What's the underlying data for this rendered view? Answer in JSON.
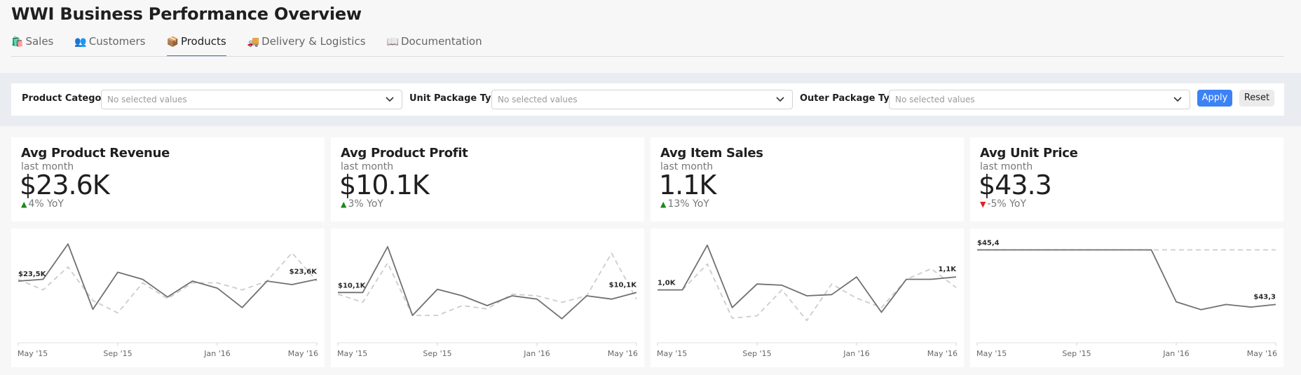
{
  "app": {
    "title": "WWI Business Performance Overview"
  },
  "tabs": [
    {
      "icon": "🛍️",
      "icon_name": "shopping-bags-icon",
      "label": "Sales",
      "active": false
    },
    {
      "icon": "👥",
      "icon_name": "people-icon",
      "label": "Customers",
      "active": false
    },
    {
      "icon": "📦",
      "icon_name": "package-icon",
      "label": "Products",
      "active": true
    },
    {
      "icon": "🚚",
      "icon_name": "truck-icon",
      "label": "Delivery & Logistics",
      "active": false
    },
    {
      "icon": "📖",
      "icon_name": "book-icon",
      "label": "Documentation",
      "active": false
    }
  ],
  "filters": {
    "items": [
      {
        "label": "Product Category",
        "placeholder": "No selected values"
      },
      {
        "label": "Unit Package Type",
        "placeholder": "No selected values"
      },
      {
        "label": "Outer Package Type",
        "placeholder": "No selected values"
      }
    ],
    "apply_label": "Apply",
    "reset_label": "Reset"
  },
  "kpis": [
    {
      "title": "Avg Product Revenue",
      "period": "last month",
      "value": "$23.6K",
      "delta": "4% YoY",
      "direction": "up"
    },
    {
      "title": "Avg Product Profit",
      "period": "last month",
      "value": "$10.1K",
      "delta": "3% YoY",
      "direction": "up"
    },
    {
      "title": "Avg Item Sales",
      "period": "last month",
      "value": "1.1K",
      "delta": "13% YoY",
      "direction": "up"
    },
    {
      "title": "Avg Unit Price",
      "period": "last month",
      "value": "$43.3",
      "delta": "-5% YoY",
      "direction": "down"
    }
  ],
  "colors": {
    "accent": "#3b6fe0",
    "apply_button": "#3b82f6",
    "up": "#1a8a1a",
    "down": "#e02020",
    "series_current": "#707070",
    "series_previous": "#cccccc"
  },
  "chart_data": [
    {
      "type": "line",
      "x_ticks": [
        "May '15",
        "Sep '15",
        "Jan '16",
        "May '16"
      ],
      "series": [
        {
          "style": "solid",
          "values": [
            23.5,
            23.6,
            25.6,
            21.9,
            24.0,
            23.6,
            22.6,
            23.5,
            23.1,
            22.0,
            23.5,
            23.3,
            23.6
          ]
        },
        {
          "style": "dashed",
          "values": [
            23.6,
            23.0,
            24.3,
            22.4,
            21.7,
            23.4,
            22.5,
            23.4,
            23.4,
            23.0,
            23.5,
            25.1,
            23.5
          ]
        }
      ],
      "labels": {
        "first": "$23,5K",
        "last": "$23,6K"
      }
    },
    {
      "type": "line",
      "x_ticks": [
        "May '15",
        "Sep '15",
        "Jan '16",
        "May '16"
      ],
      "series": [
        {
          "style": "solid",
          "values": [
            10.0,
            10.0,
            11.4,
            9.3,
            10.1,
            9.9,
            9.6,
            9.9,
            9.8,
            9.2,
            9.9,
            9.8,
            10.0
          ]
        },
        {
          "style": "dashed",
          "values": [
            9.95,
            9.7,
            10.9,
            9.3,
            9.3,
            9.6,
            9.5,
            9.95,
            9.9,
            9.7,
            9.9,
            11.2,
            9.8
          ]
        }
      ],
      "labels": {
        "first": "$10,1K",
        "last": "$10,1K"
      }
    },
    {
      "type": "line",
      "x_ticks": [
        "May '15",
        "Sep '15",
        "Jan '16",
        "May '16"
      ],
      "series": [
        {
          "style": "solid",
          "values": [
            1.0,
            1.0,
            1.38,
            0.85,
            1.05,
            1.04,
            0.95,
            0.96,
            1.11,
            0.81,
            1.09,
            1.09,
            1.11
          ]
        },
        {
          "style": "dashed",
          "values": [
            1.0,
            1.0,
            1.22,
            0.76,
            0.78,
            1.0,
            0.74,
            1.05,
            0.93,
            0.85,
            1.09,
            1.18,
            1.02
          ]
        }
      ],
      "labels": {
        "first": "1,0K",
        "last": "1,1K"
      }
    },
    {
      "type": "line",
      "x_ticks": [
        "May '15",
        "Sep '15",
        "Jan '16",
        "May '16"
      ],
      "series": [
        {
          "style": "solid",
          "values": [
            45.4,
            45.4,
            45.4,
            45.4,
            45.4,
            45.4,
            45.4,
            45.4,
            43.4,
            43.1,
            43.3,
            43.2,
            43.3
          ]
        },
        {
          "style": "dashed",
          "values": [
            45.4,
            45.4,
            45.4,
            45.4,
            45.4,
            45.4,
            45.4,
            45.4,
            45.4,
            45.4,
            45.4,
            45.4,
            45.4
          ]
        }
      ],
      "labels": {
        "first": "$45,4",
        "last": "$43,3"
      }
    }
  ]
}
